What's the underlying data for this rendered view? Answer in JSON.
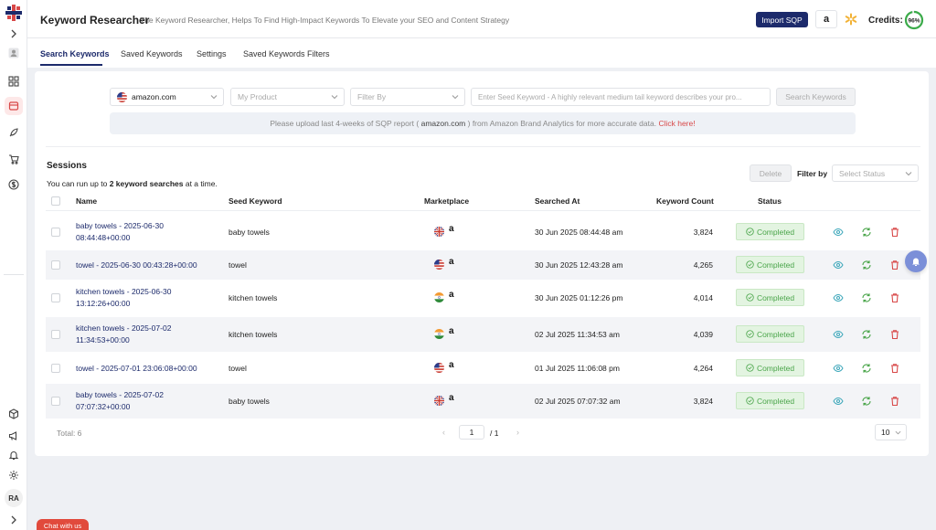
{
  "header": {
    "app_title": "Keyword Researcher",
    "app_subtitle": "The Keyword Researcher, Helps To Find High-Impact Keywords To Elevate your SEO and Content Strategy",
    "import_label": "Import SQP",
    "amazon_glyph": "a",
    "credits_label": "Credits:",
    "credits_value": "96%",
    "credits_fraction": 0.96
  },
  "sidebar": {
    "avatar_initials": "RA",
    "icons": [
      "logo-icon",
      "chevron-right-icon",
      "user-icon",
      "grid-icon",
      "keyword-icon",
      "rocket-icon",
      "cart-icon",
      "dollar-icon",
      "box-icon",
      "megaphone-icon",
      "bell-icon",
      "gear-icon",
      "chevron-right-icon"
    ]
  },
  "tabs": [
    {
      "label": "Search Keywords",
      "active": true
    },
    {
      "label": "Saved Keywords",
      "active": false
    },
    {
      "label": "Settings",
      "active": false
    },
    {
      "label": "Saved Keywords Filters",
      "active": false
    }
  ],
  "search": {
    "marketplace_value": "amazon.com",
    "product_placeholder": "My Product",
    "filter_placeholder": "Filter By",
    "seed_placeholder": "Enter Seed Keyword - A highly relevant medium tail keyword describes your pro...",
    "search_button": "Search Keywords"
  },
  "notice": {
    "text_before": "Please upload last 4-weeks of SQP report ( ",
    "marketplace": "amazon.com",
    "text_after": " ) from Amazon Brand Analytics for more accurate data. ",
    "link": "Click here!"
  },
  "sessions": {
    "title": "Sessions",
    "note_before": "You can run up to ",
    "note_bold": "2 keyword searches",
    "note_after": " at a time.",
    "delete_label": "Delete",
    "filter_label": "Filter by",
    "status_placeholder": "Select Status"
  },
  "table": {
    "headers": {
      "name": "Name",
      "seed": "Seed Keyword",
      "marketplace": "Marketplace",
      "searched_at": "Searched At",
      "count": "Keyword Count",
      "status": "Status"
    },
    "rows": [
      {
        "name_line1": "baby towels - 2025-06-30",
        "name_line2": "08:44:48+00:00",
        "seed": "baby towels",
        "flag": "uk",
        "searched_at": "30 Jun 2025 08:44:48 am",
        "count": "3,824",
        "status": "Completed"
      },
      {
        "name_line1": "towel - 2025-06-30 00:43:28+00:00",
        "name_line2": "",
        "seed": "towel",
        "flag": "us",
        "searched_at": "30 Jun 2025 12:43:28 am",
        "count": "4,265",
        "status": "Completed"
      },
      {
        "name_line1": "kitchen towels - 2025-06-30",
        "name_line2": "13:12:26+00:00",
        "seed": "kitchen towels",
        "flag": "in",
        "searched_at": "30 Jun 2025 01:12:26 pm",
        "count": "4,014",
        "status": "Completed"
      },
      {
        "name_line1": "kitchen towels - 2025-07-02",
        "name_line2": "11:34:53+00:00",
        "seed": "kitchen towels",
        "flag": "in",
        "searched_at": "02 Jul 2025 11:34:53 am",
        "count": "4,039",
        "status": "Completed"
      },
      {
        "name_line1": "towel - 2025-07-01 23:06:08+00:00",
        "name_line2": "",
        "seed": "towel",
        "flag": "us",
        "searched_at": "01 Jul 2025 11:06:08 pm",
        "count": "4,264",
        "status": "Completed"
      },
      {
        "name_line1": "baby towels - 2025-07-02",
        "name_line2": "07:07:32+00:00",
        "seed": "baby towels",
        "flag": "uk",
        "searched_at": "02 Jul 2025 07:07:32 am",
        "count": "3,824",
        "status": "Completed"
      }
    ]
  },
  "pagination": {
    "total": "Total: 6",
    "prev": "‹",
    "current_page": "1",
    "of_pages": "/ 1",
    "next": "›",
    "page_size": "10"
  },
  "chat_label": "Chat with us",
  "colors": {
    "primary": "#1c2a6b",
    "danger": "#d84848",
    "success": "#4aa54a",
    "success_bg": "#e3f4e1",
    "teal": "#3aa6b9",
    "credits_ring": "#3bab4a"
  }
}
